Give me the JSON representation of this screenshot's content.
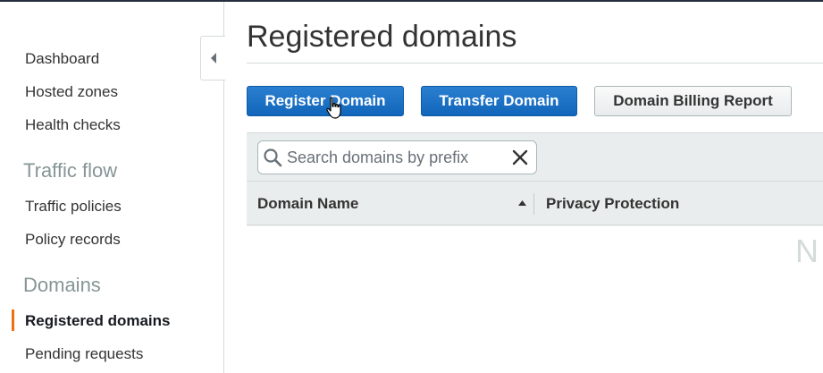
{
  "sidebar": {
    "items": [
      {
        "label": "Dashboard"
      },
      {
        "label": "Hosted zones"
      },
      {
        "label": "Health checks"
      }
    ],
    "sections": [
      {
        "title": "Traffic flow",
        "items": [
          {
            "label": "Traffic policies"
          },
          {
            "label": "Policy records"
          }
        ]
      },
      {
        "title": "Domains",
        "items": [
          {
            "label": "Registered domains",
            "active": true
          },
          {
            "label": "Pending requests"
          }
        ]
      }
    ]
  },
  "main": {
    "title": "Registered domains",
    "buttons": {
      "register": "Register Domain",
      "transfer": "Transfer Domain",
      "billing": "Domain Billing Report"
    },
    "search": {
      "placeholder": "Search domains by prefix",
      "value": ""
    },
    "table": {
      "columns": [
        {
          "label": "Domain Name",
          "sort": "ascending"
        },
        {
          "label": "Privacy Protection"
        }
      ],
      "empty_text_visible": "N"
    }
  },
  "colors": {
    "primary_button": "#1166bb",
    "active_accent": "#ec7211",
    "header_bg": "#eaeded"
  }
}
